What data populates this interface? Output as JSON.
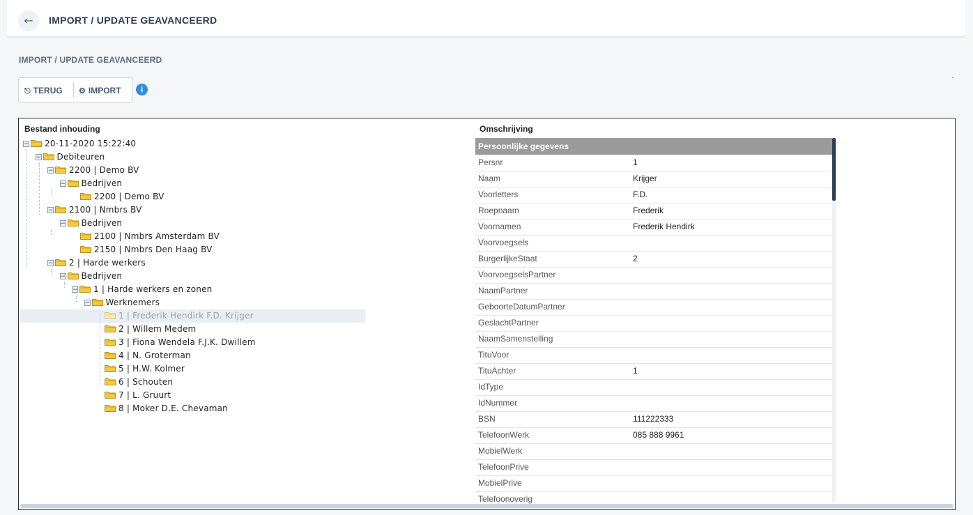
{
  "header": {
    "title": "IMPORT / UPDATE GEAVANCEERD",
    "back_icon": "arrow-left-icon"
  },
  "section": {
    "title": "IMPORT / UPDATE GEAVANCEERD"
  },
  "toolbar": {
    "back_label": "TERUG",
    "import_label": "IMPORT",
    "info_icon": "info-icon"
  },
  "left_panel": {
    "heading": "Bestand inhouding"
  },
  "right_panel": {
    "heading": "Omschrijving"
  },
  "tree": [
    {
      "label": "20-11-2020 15:22:40",
      "level": 0,
      "expander": true
    },
    {
      "label": "Debiteuren",
      "level": 1,
      "expander": true
    },
    {
      "label": "2200 | Demo BV",
      "level": 2,
      "expander": true
    },
    {
      "label": "Bedrijven",
      "level": 3,
      "expander": true
    },
    {
      "label": "2200 | Demo BV",
      "level": 4,
      "expander": false
    },
    {
      "label": "2100 | Nmbrs BV",
      "level": 2,
      "expander": true
    },
    {
      "label": "Bedrijven",
      "level": 3,
      "expander": true
    },
    {
      "label": "2100 | Nmbrs Amsterdam BV",
      "level": 4,
      "expander": false
    },
    {
      "label": "2150 | Nmbrs Den Haag BV",
      "level": 4,
      "expander": false
    },
    {
      "label": "2 | Harde werkers",
      "level": 2,
      "expander": true
    },
    {
      "label": "Bedrijven",
      "level": 3,
      "expander": true
    },
    {
      "label": "1 | Harde werkers en zonen",
      "level": 4,
      "expander": true
    },
    {
      "label": "Werknemers",
      "level": 5,
      "expander": true
    },
    {
      "label": "1 | Frederik Hendirk F.D. Krijger",
      "level": 6,
      "expander": false,
      "selected": true
    },
    {
      "label": "2 | Willem Medem",
      "level": 6,
      "expander": false
    },
    {
      "label": "3 | Fiona Wendela F.J.K. Dwillem",
      "level": 6,
      "expander": false
    },
    {
      "label": "4 | N. Groterman",
      "level": 6,
      "expander": false
    },
    {
      "label": "5 | H.W. Kolmer",
      "level": 6,
      "expander": false
    },
    {
      "label": "6 | Schouten",
      "level": 6,
      "expander": false
    },
    {
      "label": "7 | L. Gruurt",
      "level": 6,
      "expander": false
    },
    {
      "label": "8 | Moker D.E. Chevaman",
      "level": 6,
      "expander": false
    }
  ],
  "details": {
    "group_title": "Persoonlijke gegevens",
    "rows": [
      {
        "key": "Persnr",
        "value": "1"
      },
      {
        "key": "Naam",
        "value": "Krijger"
      },
      {
        "key": "Voorletters",
        "value": "F.D."
      },
      {
        "key": "Roepnaam",
        "value": "Frederik"
      },
      {
        "key": "Voornamen",
        "value": "Frederik Hendirk"
      },
      {
        "key": "Voorvoegsels",
        "value": ""
      },
      {
        "key": "BurgerlijkeStaat",
        "value": "2"
      },
      {
        "key": "VoorvoegselsPartner",
        "value": ""
      },
      {
        "key": "NaamPartner",
        "value": ""
      },
      {
        "key": "GeboorteDatumPartner",
        "value": ""
      },
      {
        "key": "GeslachtPartner",
        "value": ""
      },
      {
        "key": "NaamSamenstelling",
        "value": ""
      },
      {
        "key": "TituVoor",
        "value": ""
      },
      {
        "key": "TituAchter",
        "value": "1"
      },
      {
        "key": "IdType",
        "value": ""
      },
      {
        "key": "IdNummer",
        "value": ""
      },
      {
        "key": "BSN",
        "value": "111222333"
      },
      {
        "key": "TelefoonWerk",
        "value": "085 888 9961"
      },
      {
        "key": "MobielWerk",
        "value": ""
      },
      {
        "key": "TelefoonPrive",
        "value": ""
      },
      {
        "key": "MobielPrive",
        "value": ""
      },
      {
        "key": "Telefoonoverig",
        "value": ""
      }
    ]
  },
  "colors": {
    "header_gray": "#9b9b9b",
    "info_blue": "#2f8fd8",
    "folder_yellow": "#f5c842",
    "selected_bg": "#e9eef5"
  }
}
